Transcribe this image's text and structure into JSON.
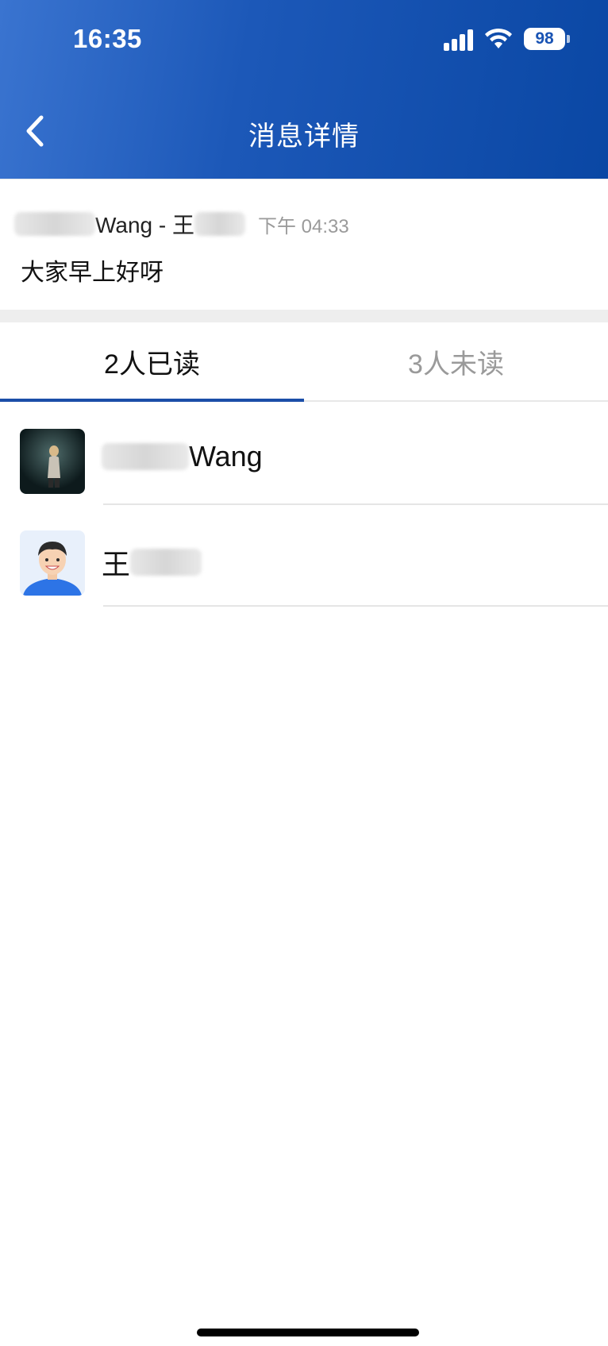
{
  "status_bar": {
    "time": "16:35",
    "battery": "98"
  },
  "header": {
    "title": "消息详情",
    "back_icon": "chevron-left-icon"
  },
  "message": {
    "sender_visible": "Wang - 王",
    "time": "下午 04:33",
    "content": "大家早上好呀"
  },
  "tabs": [
    {
      "label": "2人已读",
      "active": true
    },
    {
      "label": "3人未读",
      "active": false
    }
  ],
  "readers": [
    {
      "name_visible": "Wang",
      "avatar": "photo-avatar"
    },
    {
      "name_visible": "王",
      "avatar": "cartoon-avatar"
    }
  ],
  "colors": {
    "header_start": "#3a74d0",
    "header_end": "#0a47a4",
    "tab_indicator": "#1b4ea8"
  }
}
